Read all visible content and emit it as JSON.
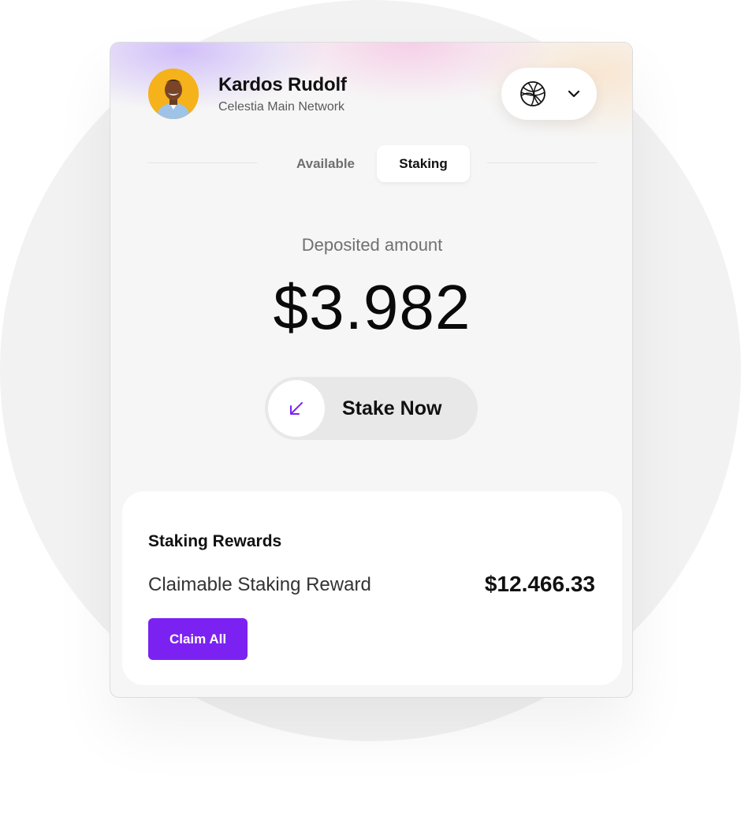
{
  "user": {
    "name": "Kardos Rudolf",
    "network": "Celestia Main Network",
    "avatar_icon": "person-avatar"
  },
  "network_selector": {
    "icon": "globe-icon",
    "dropdown_icon": "chevron-down-icon"
  },
  "tabs": [
    {
      "label": "Available",
      "active": false
    },
    {
      "label": "Staking",
      "active": true
    }
  ],
  "deposit": {
    "label": "Deposited amount",
    "amount": "$3.982"
  },
  "stake_button": {
    "label": "Stake Now",
    "icon": "arrow-down-left-icon"
  },
  "rewards": {
    "title": "Staking Rewards",
    "row_label": "Claimable Staking Reward",
    "row_value": "$12.466.33",
    "claim_label": "Claim All"
  },
  "colors": {
    "accent": "#7b22f2",
    "avatar_bg": "#f5b21a"
  }
}
